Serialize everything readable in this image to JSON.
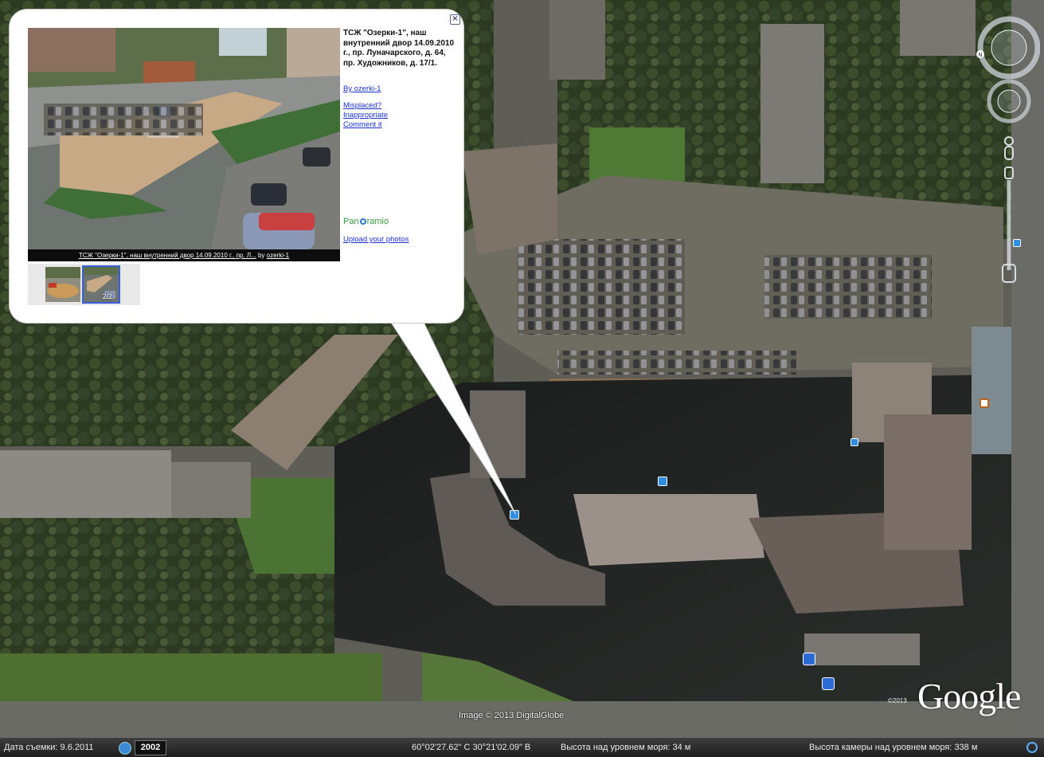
{
  "balloon": {
    "title": "ТСЖ \"Озерки-1\", наш внутренний двор 14.09.2010 г., пр. Луначарского, д. 64, пр. Художников, д. 17/1.",
    "author_link": "By ozerki-1",
    "links": [
      "Misplaced?",
      "Inappropriate",
      "Comment it"
    ],
    "panoramio_label": [
      "Pan",
      "ramio"
    ],
    "upload_link": "Upload your photos",
    "caption_text": "ТСЖ \"Озерки-1\", наш внутренний двор 14.09.2010 г., пр. Л...",
    "caption_by": "by",
    "caption_author": "ozerki-1",
    "thumb_counter": "2/2",
    "close_label": "×"
  },
  "map": {
    "image_credit": "Image © 2013 DigitalGlobe",
    "logo": "Google",
    "logo_copyright": "©2013"
  },
  "status": {
    "date_label": "Дата съемки: 9.6.2011",
    "year": "2002",
    "coordinates": "60°02'27.62\" С   30°21'02.09\" В",
    "elevation": "Высота над уровнем моря:   34 м",
    "eye_alt": "Высота камеры над уровнем моря:   338 м"
  }
}
